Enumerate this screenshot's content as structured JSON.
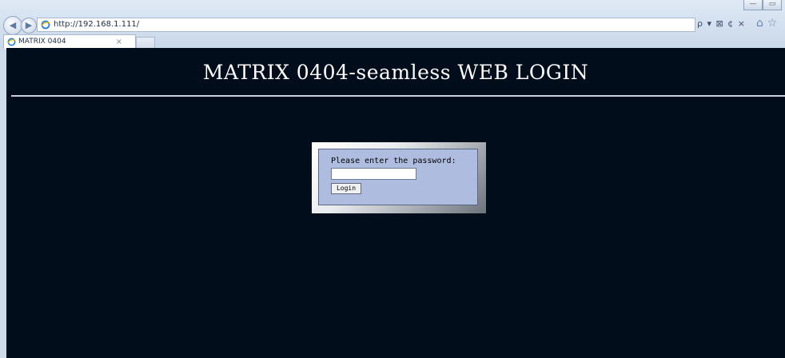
{
  "browser": {
    "url": "http://192.168.1.111/",
    "tab_title": "MATRIX 0404",
    "tab_close": "×",
    "window_controls": [
      "—",
      "▭"
    ],
    "address_tools": "ρ ▾ ⊠ ¢ ×",
    "toolbar_icons": [
      "home-icon",
      "star-icon"
    ]
  },
  "page": {
    "title": "MATRIX 0404-seamless WEB LOGIN",
    "prompt": "Please enter the password:",
    "password_value": "",
    "login_label": "Login"
  },
  "colors": {
    "page_background": "#020d1c",
    "panel_background": "#aebcdf",
    "title_text": "#ffffff"
  }
}
